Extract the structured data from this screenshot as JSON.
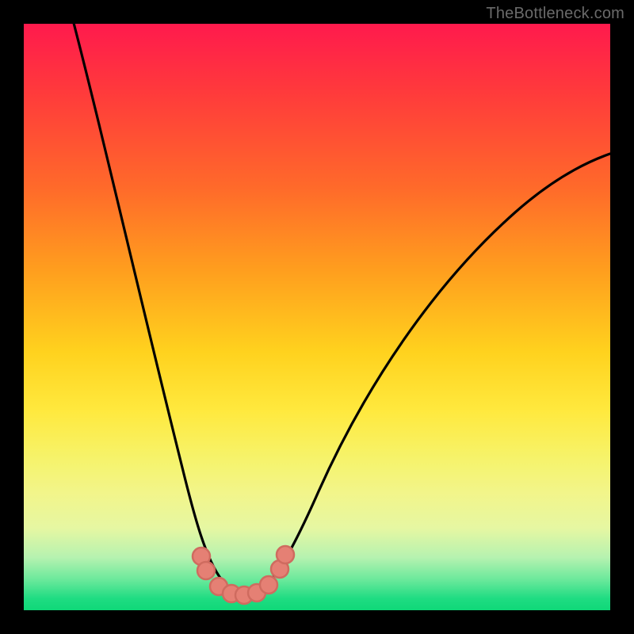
{
  "watermark": {
    "text": "TheBottleneck.com"
  },
  "colors": {
    "frame": "#000000",
    "curve_stroke": "#000000",
    "dot_fill": "#e58074",
    "dot_stroke": "#cf6b5f"
  },
  "chart_data": {
    "type": "line",
    "title": "",
    "xlabel": "",
    "ylabel": "",
    "xlim": [
      0,
      100
    ],
    "ylim": [
      0,
      100
    ],
    "grid": false,
    "legend": false,
    "series": [
      {
        "name": "bottleneck-curve",
        "x": [
          5,
          8,
          12,
          16,
          20,
          24,
          28,
          31,
          33,
          35,
          37,
          39,
          42,
          46,
          52,
          60,
          70,
          82,
          96,
          100
        ],
        "y": [
          100,
          87,
          72,
          58,
          44,
          32,
          20,
          12,
          6,
          2,
          2,
          4,
          8,
          16,
          28,
          42,
          56,
          68,
          78,
          80
        ]
      }
    ],
    "annotations": {
      "floor_dots_x": [
        29,
        30.5,
        33,
        35,
        36.5,
        38.5,
        40,
        41,
        42.5
      ],
      "floor_dots_y": [
        6,
        4,
        2,
        2,
        2,
        2,
        4,
        6,
        8
      ]
    }
  }
}
